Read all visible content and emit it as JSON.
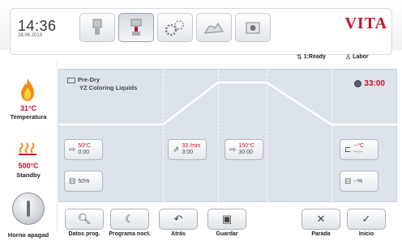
{
  "header": {
    "time": "14:36",
    "date": "28.06.2013",
    "brand": "VITA",
    "mode_buttons": [
      {
        "icon": "furnace-icon"
      },
      {
        "icon": "furnace-open-icon"
      },
      {
        "icon": "gears-icon"
      },
      {
        "icon": "hands-icon"
      },
      {
        "icon": "camera-icon"
      }
    ],
    "status_ready": "1:Ready",
    "status_labor": "Labor"
  },
  "sidebar": {
    "temperature_value": "31°C",
    "temperature_label": "Temperatura",
    "standby_value": "500°C",
    "standby_label": "Standby",
    "power_label": "Horno apagad"
  },
  "program": {
    "name_line1": "Pre-Dry",
    "name_line2": "YZ Coloring Liquids",
    "timer": "33:00",
    "steps": [
      {
        "temp": "50°C",
        "time": "0:00"
      },
      {
        "vacuum": "50%"
      },
      {
        "temp": "33 /min",
        "time": "3:00"
      },
      {
        "temp": "150°C",
        "time": "30:00"
      },
      {
        "temp": "--°C",
        "time": "--:--"
      },
      {
        "vacuum": "--%"
      }
    ],
    "curve": {
      "x": [
        0,
        1,
        2,
        3,
        4,
        5
      ],
      "y": [
        50,
        50,
        150,
        150,
        50,
        50
      ]
    }
  },
  "toolbar": {
    "data_label": "Datos prog.",
    "night_label": "Programa noct.",
    "back_label": "Atrás",
    "save_label": "Guardar",
    "stop_label": "Parada",
    "start_label": "Inicio"
  },
  "colors": {
    "accent_red": "#c8102e",
    "panel_bg": "#dde3ea"
  }
}
